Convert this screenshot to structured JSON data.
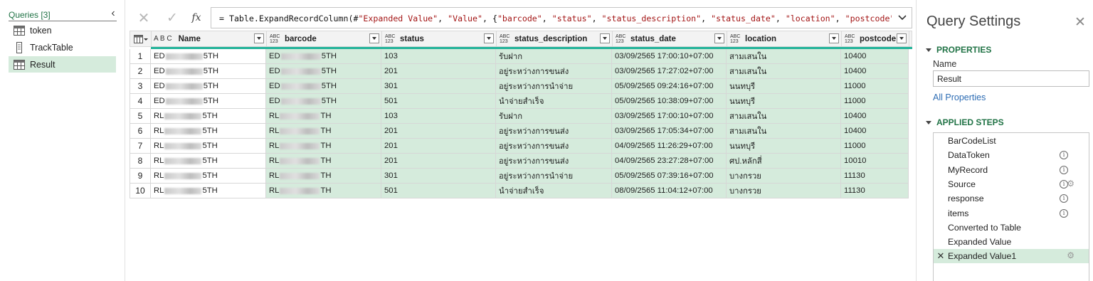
{
  "queries": {
    "title": "Queries [3]",
    "items": [
      {
        "label": "token",
        "icon": "table-icon"
      },
      {
        "label": "TrackTable",
        "icon": "function-icon"
      },
      {
        "label": "Result",
        "icon": "table-icon",
        "selected": true
      }
    ]
  },
  "formula": {
    "fx": "fx",
    "parts": [
      {
        "t": "= Table.ExpandRecordColumn(#",
        "s": false
      },
      {
        "t": "\"Expanded Value\"",
        "s": true
      },
      {
        "t": ", ",
        "s": false
      },
      {
        "t": "\"Value\"",
        "s": true
      },
      {
        "t": ", {",
        "s": false
      },
      {
        "t": "\"barcode\"",
        "s": true
      },
      {
        "t": ", ",
        "s": false
      },
      {
        "t": "\"status\"",
        "s": true
      },
      {
        "t": ", ",
        "s": false
      },
      {
        "t": "\"status_description\"",
        "s": true
      },
      {
        "t": ", ",
        "s": false
      },
      {
        "t": "\"status_date\"",
        "s": true
      },
      {
        "t": ", ",
        "s": false
      },
      {
        "t": "\"location\"",
        "s": true
      },
      {
        "t": ", ",
        "s": false
      },
      {
        "t": "\"postcode\"",
        "s": true
      },
      {
        "t": ",",
        "s": false
      }
    ]
  },
  "grid": {
    "columns": [
      {
        "key": "name",
        "label": "Name",
        "type": "text"
      },
      {
        "key": "barcode",
        "label": "barcode",
        "type": "any"
      },
      {
        "key": "status",
        "label": "status",
        "type": "any"
      },
      {
        "key": "desc",
        "label": "status_description",
        "type": "any"
      },
      {
        "key": "date",
        "label": "status_date",
        "type": "any"
      },
      {
        "key": "loc",
        "label": "location",
        "type": "any"
      },
      {
        "key": "post",
        "label": "postcode",
        "type": "any"
      }
    ],
    "type_any_top": "ABC",
    "type_any_bottom": "123",
    "type_text": "A B C",
    "rows": [
      {
        "n": "1",
        "pre": "ED",
        "suf": "5TH",
        "bpre": "ED",
        "bsuf": "5TH",
        "status": "103",
        "desc": "รับฝาก",
        "date": "03/09/2565 17:00:10+07:00",
        "loc": "สามเสนใน",
        "post": "10400"
      },
      {
        "n": "2",
        "pre": "ED",
        "suf": "5TH",
        "bpre": "ED",
        "bsuf": "5TH",
        "status": "201",
        "desc": "อยู่ระหว่างการขนส่ง",
        "date": "03/09/2565 17:27:02+07:00",
        "loc": "สามเสนใน",
        "post": "10400"
      },
      {
        "n": "3",
        "pre": "ED",
        "suf": "5TH",
        "bpre": "ED",
        "bsuf": "5TH",
        "status": "301",
        "desc": "อยู่ระหว่างการนำจ่าย",
        "date": "05/09/2565 09:24:16+07:00",
        "loc": "นนทบุรี",
        "post": "11000"
      },
      {
        "n": "4",
        "pre": "ED",
        "suf": "5TH",
        "bpre": "ED",
        "bsuf": "5TH",
        "status": "501",
        "desc": "นำจ่ายสำเร็จ",
        "date": "05/09/2565 10:38:09+07:00",
        "loc": "นนทบุรี",
        "post": "11000"
      },
      {
        "n": "5",
        "pre": "RL",
        "suf": "5TH",
        "bpre": "RL",
        "bsuf": "TH",
        "status": "103",
        "desc": "รับฝาก",
        "date": "03/09/2565 17:00:10+07:00",
        "loc": "สามเสนใน",
        "post": "10400"
      },
      {
        "n": "6",
        "pre": "RL",
        "suf": "5TH",
        "bpre": "RL",
        "bsuf": "TH",
        "status": "201",
        "desc": "อยู่ระหว่างการขนส่ง",
        "date": "03/09/2565 17:05:34+07:00",
        "loc": "สามเสนใน",
        "post": "10400"
      },
      {
        "n": "7",
        "pre": "RL",
        "suf": "5TH",
        "bpre": "RL",
        "bsuf": "TH",
        "status": "201",
        "desc": "อยู่ระหว่างการขนส่ง",
        "date": "04/09/2565 11:26:29+07:00",
        "loc": "นนทบุรี",
        "post": "11000"
      },
      {
        "n": "8",
        "pre": "RL",
        "suf": "5TH",
        "bpre": "RL",
        "bsuf": "TH",
        "status": "201",
        "desc": "อยู่ระหว่างการขนส่ง",
        "date": "04/09/2565 23:27:28+07:00",
        "loc": "ศป.หลักสี่",
        "post": "10010"
      },
      {
        "n": "9",
        "pre": "RL",
        "suf": "5TH",
        "bpre": "RL",
        "bsuf": "TH",
        "status": "301",
        "desc": "อยู่ระหว่างการนำจ่าย",
        "date": "05/09/2565 07:39:16+07:00",
        "loc": "บางกรวย",
        "post": "11130"
      },
      {
        "n": "10",
        "pre": "RL",
        "suf": "5TH",
        "bpre": "RL",
        "bsuf": "TH",
        "status": "501",
        "desc": "นำจ่ายสำเร็จ",
        "date": "08/09/2565 11:04:12+07:00",
        "loc": "บางกรวย",
        "post": "11130"
      }
    ]
  },
  "settings": {
    "title": "Query Settings",
    "properties_heading": "PROPERTIES",
    "name_label": "Name",
    "name_value": "Result",
    "all_properties": "All Properties",
    "steps_heading": "APPLIED STEPS",
    "steps": [
      {
        "label": "BarCodeList",
        "info": false,
        "gear": false
      },
      {
        "label": "DataToken",
        "info": true,
        "gear": false
      },
      {
        "label": "MyRecord",
        "info": true,
        "gear": false
      },
      {
        "label": "Source",
        "info": true,
        "gear": true
      },
      {
        "label": "response",
        "info": true,
        "gear": false
      },
      {
        "label": "items",
        "info": true,
        "gear": false
      },
      {
        "label": "Converted to Table",
        "info": false,
        "gear": false
      },
      {
        "label": "Expanded Value",
        "info": false,
        "gear": false
      },
      {
        "label": "Expanded Value1",
        "info": false,
        "gear": true,
        "selected": true
      }
    ]
  },
  "colors": {
    "accent": "#217346",
    "selected_bg": "#d5ebdc",
    "quality_bar": "#22b39a",
    "link": "#2e6db4"
  }
}
